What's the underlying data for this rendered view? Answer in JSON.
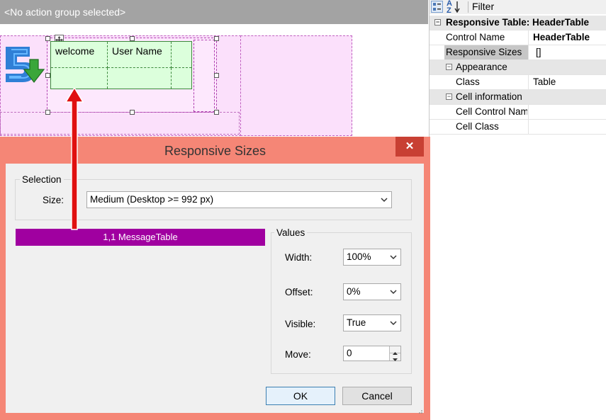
{
  "canvas": {
    "action_group_text": "<No action group selected>",
    "header_cells": {
      "welcome": "welcome",
      "user_name": "User Name"
    }
  },
  "properties": {
    "toolbar": {
      "categorized_icon": "categorized-icon",
      "alphabetical_icon": "alphabetical-sort-icon",
      "filter_label": "Filter"
    },
    "object_title": "Responsive Table: HeaderTable",
    "rows": [
      {
        "name": "Control Name",
        "value": "HeaderTable"
      },
      {
        "name": "Responsive Sizes",
        "value": "[]"
      }
    ],
    "appearance": {
      "category": "Appearance",
      "class_name": "Class",
      "class_value": "Table"
    },
    "cell_information": {
      "category": "Cell information",
      "cell_control_name": "Cell Control Nam",
      "cell_class": "Cell Class"
    }
  },
  "dialog": {
    "title": "Responsive Sizes",
    "close_glyph": "✕",
    "selection": {
      "group_title": "Selection",
      "size_label": "Size:",
      "size_value": "Medium (Desktop >= 992 px)"
    },
    "item_list": [
      "1,1 MessageTable"
    ],
    "values": {
      "group_title": "Values",
      "width_label": "Width:",
      "width_value": "100%",
      "offset_label": "Offset:",
      "offset_value": "0%",
      "visible_label": "Visible:",
      "visible_value": "True",
      "move_label": "Move:",
      "move_value": "0"
    },
    "ok_label": "OK",
    "cancel_label": "Cancel"
  },
  "colors": {
    "dialog_frame": "#f58676",
    "close_button": "#c84033",
    "list_selection": "#a000a0",
    "annotation_arrow": "#e01010",
    "header_table_fill": "#dcffdc"
  }
}
